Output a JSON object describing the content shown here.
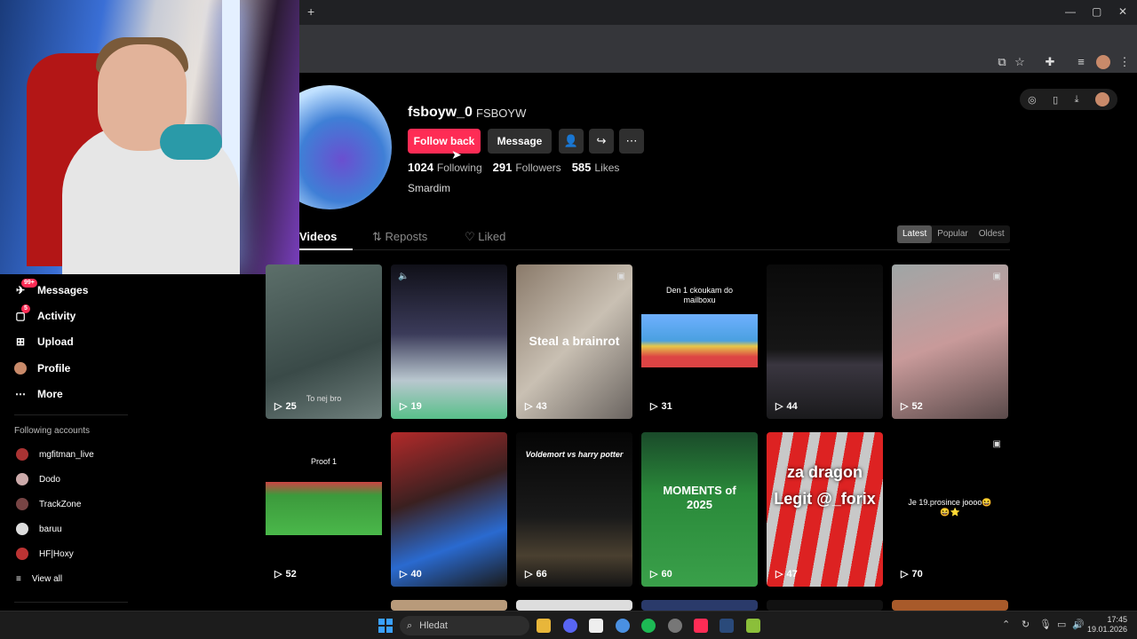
{
  "browser": {
    "new_tab_glyph": "+",
    "window_controls": [
      "—",
      "▢",
      "✕"
    ]
  },
  "profile": {
    "username": "fsboyw_0",
    "nickname": "FSBOYW",
    "follow_back_label": "Follow back",
    "message_label": "Message",
    "stats": {
      "following_count": "1024",
      "following_label": "Following",
      "followers_count": "291",
      "followers_label": "Followers",
      "likes_count": "585",
      "likes_label": "Likes"
    },
    "bio": "Smardim"
  },
  "tabs": [
    {
      "label": "Videos",
      "icon": ""
    },
    {
      "label": "Reposts",
      "icon": "repost-icon"
    },
    {
      "label": "Liked",
      "icon": "heart-outline-icon"
    }
  ],
  "sort": [
    "Latest",
    "Popular",
    "Oldest"
  ],
  "sidebar": {
    "items": [
      {
        "label": "Messages",
        "icon": "messages-icon",
        "badge": "99+"
      },
      {
        "label": "Activity",
        "icon": "activity-icon",
        "badge": "5"
      },
      {
        "label": "Upload",
        "icon": "upload-icon"
      },
      {
        "label": "Profile",
        "icon": "avatar"
      },
      {
        "label": "More",
        "icon": "more-icon"
      }
    ],
    "following_title": "Following accounts",
    "following": [
      "mgfitman_live",
      "Dodo",
      "TrackZone",
      "baruu",
      "HF|Hoxy"
    ],
    "view_all": "View all"
  },
  "videos": [
    {
      "views": "25",
      "caption": "To nej bro"
    },
    {
      "views": "19",
      "caption": ""
    },
    {
      "views": "43",
      "caption": "Steal a brainrot"
    },
    {
      "views": "31",
      "caption": "Den 1 ckoukam do mailboxu"
    },
    {
      "views": "44",
      "caption": ""
    },
    {
      "views": "52",
      "caption": ""
    },
    {
      "views": "52",
      "caption": "Proof 1"
    },
    {
      "views": "40",
      "caption": ""
    },
    {
      "views": "66",
      "caption": "Voldemort vs harry potter"
    },
    {
      "views": "60",
      "caption": "MOMENTS of 2025"
    },
    {
      "views": "47",
      "caption": "za dragon Legit @_forix"
    },
    {
      "views": "70",
      "caption": "Je 19.prosince joooo😆😆⭐"
    }
  ],
  "taskbar": {
    "search_placeholder": "Hledat",
    "time": "17:45",
    "date": "19.01.2026"
  },
  "colors": {
    "accent": "#fe2c55",
    "background": "#000000",
    "surface": "#2f2f2f"
  }
}
